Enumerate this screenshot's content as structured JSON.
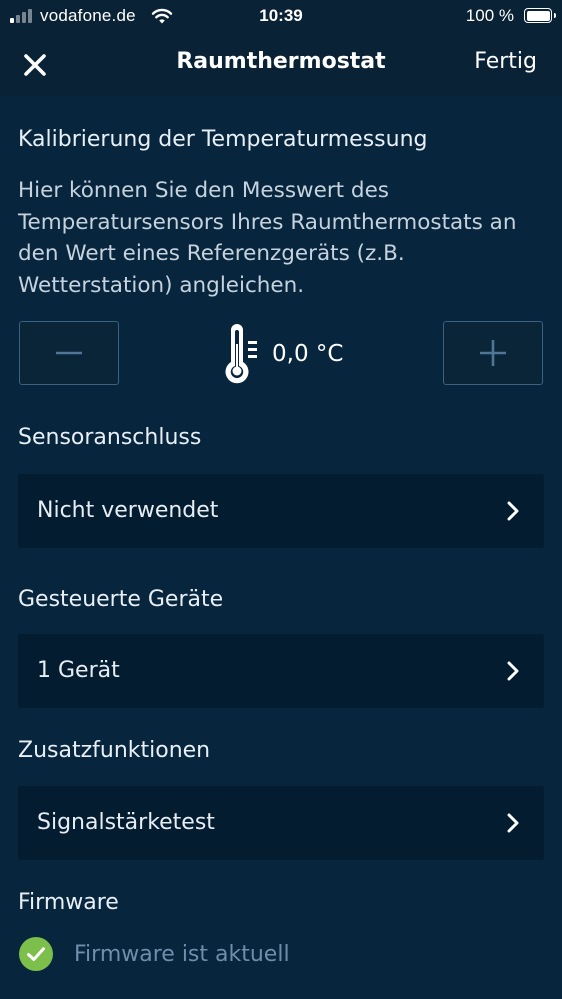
{
  "status_bar": {
    "carrier": "vodafone.de",
    "time": "10:39",
    "battery": "100 %",
    "battery_level": 1.0,
    "signal_bars": 4,
    "signal_active": 1,
    "icons": [
      "signal-icon",
      "wifi-icon",
      "battery-icon"
    ]
  },
  "nav": {
    "close_icon": "close-icon",
    "title": "Raumthermostat",
    "done_label": "Fertig"
  },
  "calibration": {
    "heading": "Kalibrierung der Temperaturmessung",
    "description": "Hier können Sie den Messwert des Temperatursensors Ihres Raumthermostats an den Wert eines Referenzgeräts (z.B. Wetterstation) angleichen.",
    "value": "0,0 °C",
    "minus_icon": "minus-icon",
    "plus_icon": "plus-icon",
    "thermometer_icon": "thermometer-icon"
  },
  "sensor": {
    "heading": "Sensoranschluss",
    "value": "Nicht verwendet"
  },
  "devices": {
    "heading": "Gesteuerte Geräte",
    "value": "1 Gerät"
  },
  "extras": {
    "heading": "Zusatzfunktionen",
    "value": "Signalstärketest"
  },
  "firmware": {
    "heading": "Firmware",
    "status": "Firmware ist aktuell",
    "icon": "check-circle-icon"
  },
  "colors": {
    "background": "#07253d",
    "nav_background": "#0a2236",
    "row_background": "#041c2f",
    "button_border": "#3c627f",
    "success_green": "#7cc04b",
    "muted_text": "#6e8eaa"
  }
}
